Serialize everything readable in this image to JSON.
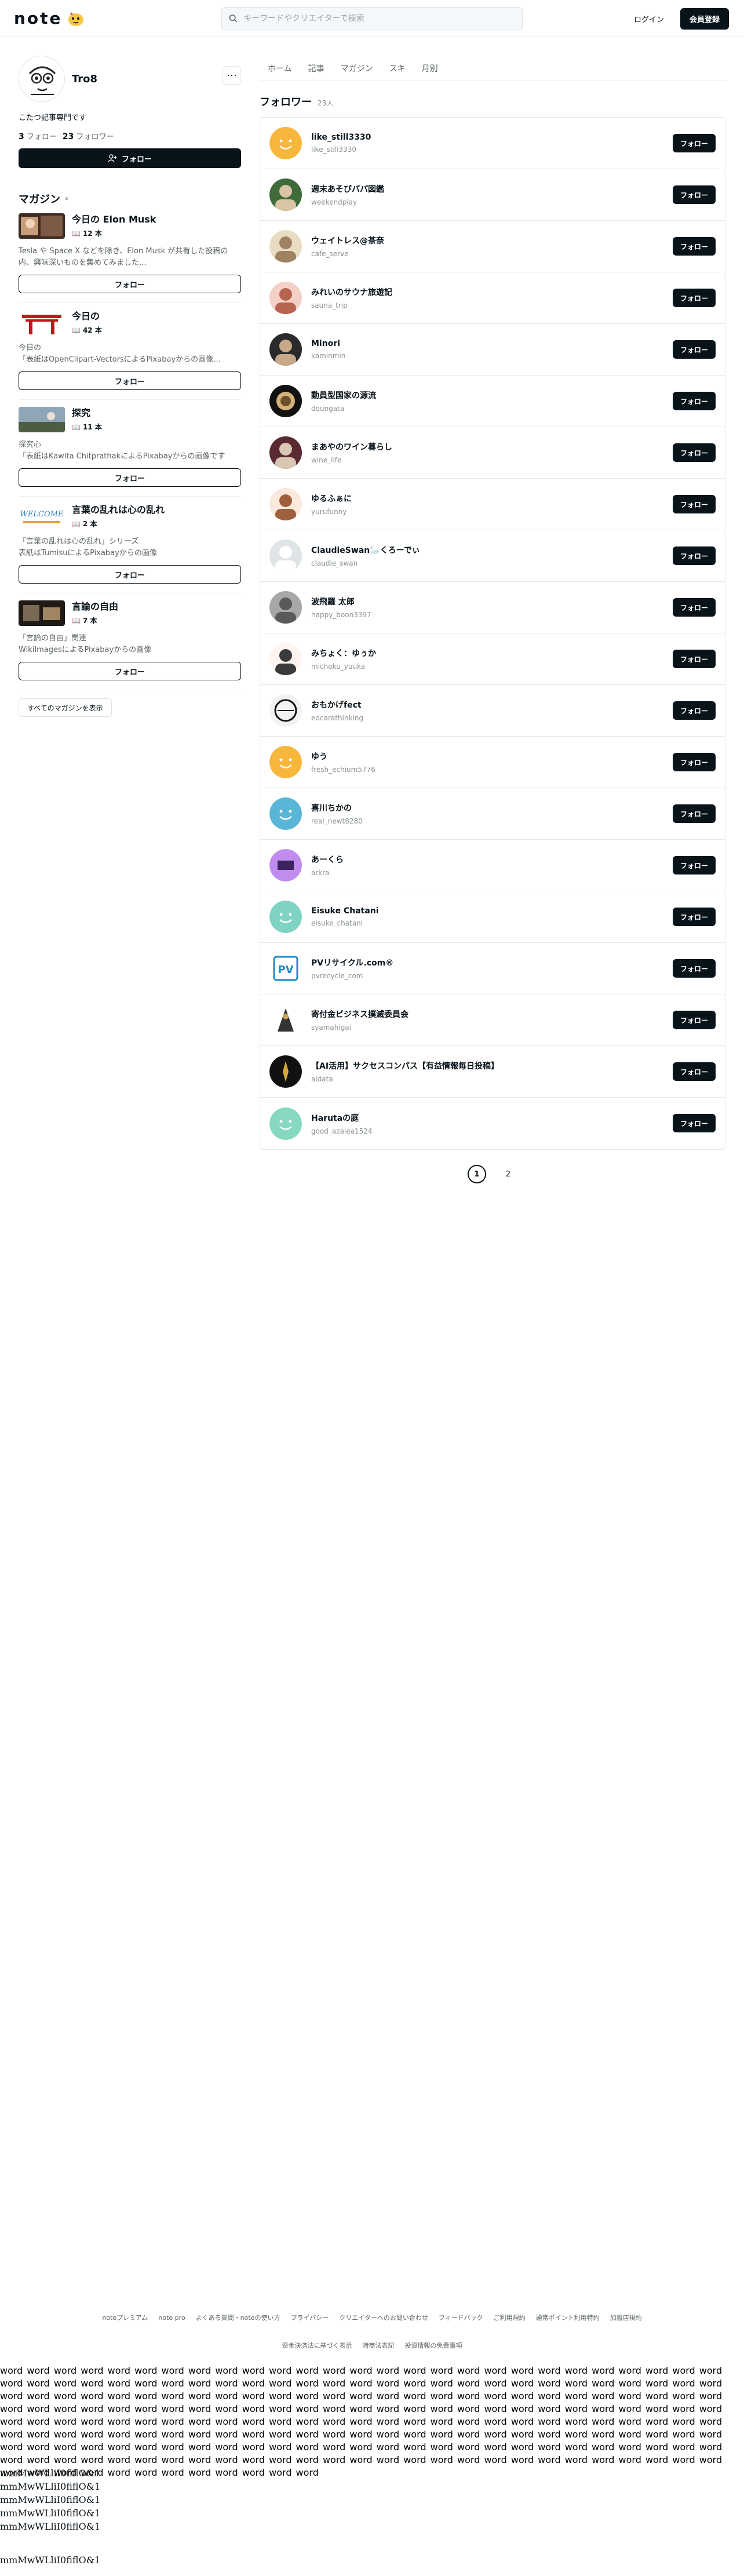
{
  "header": {
    "logo": "note",
    "search_placeholder": "キーワードやクリエイターで検索",
    "login": "ログイン",
    "signup": "会員登録"
  },
  "profile": {
    "name": "Tro8",
    "bio": "こたつ記事専門です",
    "following_count": "3",
    "following_label": "フォロー",
    "followers_count": "23",
    "followers_label": "フォロワー",
    "follow_button": "フォロー"
  },
  "magazines": {
    "title": "マガジン",
    "items": [
      {
        "title": "今日の Elon Musk",
        "count": "12 本",
        "desc": "Tesla や Space X などを除き、Elon Musk が共有した投稿の内、興味深いものを集めてみました…",
        "follow": "フォロー"
      },
      {
        "title": "今日の",
        "count": "42 本",
        "desc": "今日の\n「表紙はOpenClipart-VectorsによるPixabayからの画像…",
        "follow": "フォロー"
      },
      {
        "title": "探究",
        "count": "11 本",
        "desc": "探究心\n「表紙はKawita ChitprathakによるPixabayからの画像です",
        "follow": "フォロー"
      },
      {
        "title": "言葉の乱れは心の乱れ",
        "count": "2 本",
        "desc": "「言葉の乱れは心の乱れ」シリーズ\n表紙はTumisuによるPixabayからの画像",
        "follow": "フォロー"
      },
      {
        "title": "言論の自由",
        "count": "7 本",
        "desc": "「言論の自由」関連\nWikiImagesによるPixabayからの画像",
        "follow": "フォロー"
      }
    ],
    "all_button": "すべてのマガジンを表示"
  },
  "tabs": [
    "ホーム",
    "記事",
    "マガジン",
    "スキ",
    "月別"
  ],
  "followers": {
    "title": "フォロワー",
    "count": "23人",
    "follow_label": "フォロー",
    "items": [
      {
        "name": "like_still3330",
        "id": "like_still3330",
        "avatar": "smile-orange"
      },
      {
        "name": "週末あそびパパ図鑑",
        "id": "weekendplay",
        "avatar": "photo-green"
      },
      {
        "name": "ウェイトレス@茶奈",
        "id": "cafe_serve",
        "avatar": "photo-beige"
      },
      {
        "name": "みれいのサウナ旅遊記",
        "id": "sauna_trip",
        "avatar": "photo-pink"
      },
      {
        "name": "Minori",
        "id": "kaminmin",
        "avatar": "photo-dark"
      },
      {
        "name": "動員型国家の源流",
        "id": "doungata",
        "avatar": "photo-space"
      },
      {
        "name": "まあやのワイン暮らし",
        "id": "wine_life",
        "avatar": "photo-wine"
      },
      {
        "name": "ゆるふぁに",
        "id": "yurufunny",
        "avatar": "illust-girl"
      },
      {
        "name": "ClaudieSwan🦢くろーでぃ",
        "id": "claudie_swan",
        "avatar": "photo-swan"
      },
      {
        "name": "波飛羅 太郎",
        "id": "happy_boon3397",
        "avatar": "photo-grey"
      },
      {
        "name": "みちょく：ゆぅか",
        "id": "michoku_yuuka",
        "avatar": "illust-yuuka"
      },
      {
        "name": "おもかげfect",
        "id": "edcarathinking",
        "avatar": "illust-mono"
      },
      {
        "name": "ゆう",
        "id": "fresh_echium5776",
        "avatar": "smile-orange"
      },
      {
        "name": "喜川ちかの",
        "id": "real_newt8280",
        "avatar": "smile-blue"
      },
      {
        "name": "あーくら",
        "id": "arkra",
        "avatar": "text-purple"
      },
      {
        "name": "Eisuke Chatani",
        "id": "eisuke_chatani",
        "avatar": "smile-teal"
      },
      {
        "name": "PVリサイクル.com®",
        "id": "pvrecycle_com",
        "avatar": "logo-pv"
      },
      {
        "name": "寄付金ビジネス撲滅委員会",
        "id": "syamahigai",
        "avatar": "illust-knight"
      },
      {
        "name": "【AI活用】サクセスコンパス【有益情報毎日投稿】",
        "id": "aidata",
        "avatar": "logo-compass"
      },
      {
        "name": "Harutaの庭",
        "id": "good_azalea1524",
        "avatar": "smile-mint"
      }
    ]
  },
  "pagination": {
    "pages": [
      "1",
      "2"
    ],
    "current": "1"
  },
  "footer": {
    "links": [
      "noteプレミアム",
      "note pro",
      "よくある質問・noteの使い方",
      "プライバシー",
      "クリエイターへのお問い合わせ",
      "フィードバック",
      "ご利用規約",
      "通常ポイント利用特約",
      "加盟店規約",
      "資金決済法に基づく表示",
      "特商法表記",
      "投資情報の免責事項"
    ]
  },
  "filler": {
    "words": "word word word word word word word word word word word word word word word word word word word word word word word word word word word word word word word word word word word word word word word word word word word word word word word word word word word word word word word word word word word word word word word word word word word word word word word word word word word word word word word word word word word word word word word word word word word word word word word word word word word word word word word word word word word word word word word word word word word word word word word word word word word word word word word word word word word word word word word word word word word word word word word word word word word word word word word word word word word word word word word word word word word word word word word word word word word word word word word word word word word word word word word word word word word word word word word word word word word word word word word word word word word word word word word word word word word word word word word word word word word word word word word word word word word word",
    "lines": [
      "mmMwWLliI0fiflO&1",
      "mmMwWLliI0fiflO&1",
      "mmMwWLliI0fiflO&1",
      "mmMwWLliI0fiflO&1",
      "mmMwWLliI0fiflO&1"
    ],
    "last_line": "mmMwWLliI0fiflO&1"
  }
}
